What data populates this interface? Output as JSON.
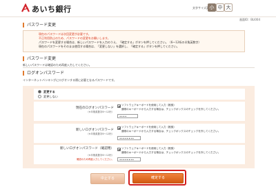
{
  "header": {
    "bank_name": "あいち銀行",
    "font_size_label": "文字サイズ変更",
    "font_sizes": [
      "小",
      "中",
      "大"
    ],
    "screen_id": "画面ID：BLI004"
  },
  "section1": {
    "title": "パスワード変更",
    "notice": [
      "現在のパスワードは次回変更が必要です。",
      "不正利用防止のため、パスワードの変更をお願いします。",
      "パスワードを変更する場合は、新しいパスワードを入力のうえ、「確定する」ボタンを押してください。（6〜12桁の半角英数字）",
      "現在のパスワードをそのまま使用する場合は、「変更しない」を選択し、「確定する」ボタンを押してください。"
    ]
  },
  "section2": {
    "title": "パスワード変更",
    "description": "新しいパスワードは確認のため再度入力してください。"
  },
  "login_pw": {
    "heading": "ログオンパスワード",
    "description": "インターネットバンキングにログオンする際に必要となるパスワードです。",
    "options": [
      "変更する",
      "変更しない"
    ],
    "selected": "変更する"
  },
  "fields": [
    {
      "label": "現在のログオンパスワード",
      "sub": "（※半角英数字6〜12桁）",
      "note": "",
      "sw_label": "ソフトウェアキーボードを使用して入力（推奨）",
      "sw_hint": "通常のキーボードから入力する場合は、チェックボックスのチェックを外してください。",
      "value": "••••"
    },
    {
      "label": "新しいログオンパスワード",
      "sub": "（※半角英数字6〜12桁）",
      "note": "",
      "sw_label": "ソフトウェアキーボードを使用して入力（推奨）",
      "sw_hint": "通常のキーボードから入力する場合は、チェックボックスのチェックを外してください。",
      "value": "••••••••"
    },
    {
      "label": "新しいログオンパスワード（確認用）",
      "sub": "（※半角英数字6〜12桁）",
      "note": "確認のため再度入力してください。",
      "sw_label": "ソフトウェアキーボードを使用して入力（推奨）",
      "sw_hint": "通常のキーボードから入力する場合は、チェックボックスのチェックを外してください。",
      "value": "••••••••"
    }
  ],
  "buttons": {
    "cancel": "中止する",
    "confirm": "確定する"
  },
  "colors": {
    "accent": "#e07a2e",
    "confirm": "#d35b12",
    "highlight": "#d21c1c",
    "warning_text": "#d9391e"
  }
}
